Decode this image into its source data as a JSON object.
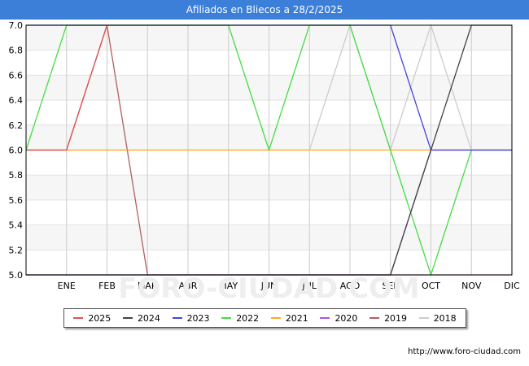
{
  "title": "Afiliados en Bliecos a 28/2/2025",
  "source_text": "http://www.foro-ciudad.com",
  "watermark_text": "FORO-CIUDAD.COM",
  "chart_data": {
    "type": "line",
    "x": [
      "",
      "ENE",
      "FEB",
      "MAR",
      "ABR",
      "MAY",
      "JUN",
      "JUL",
      "AGO",
      "SEP",
      "OCT",
      "NOV",
      "DIC"
    ],
    "ylim": [
      5.0,
      7.0
    ],
    "y_ticks": [
      "5.0",
      "5.2",
      "5.4",
      "5.6",
      "5.8",
      "6.0",
      "6.2",
      "6.4",
      "6.6",
      "6.8",
      "7.0"
    ],
    "grid": true,
    "legend_position": "bottom",
    "series": [
      {
        "name": "2025",
        "color": "#e05050",
        "values": [
          6,
          6,
          7
        ]
      },
      {
        "name": "2024",
        "color": "#444444",
        "values": [
          5,
          5,
          5,
          5,
          5,
          5,
          5,
          5,
          5,
          5,
          6,
          7,
          7
        ]
      },
      {
        "name": "2023",
        "color": "#4444dd",
        "values": [
          7,
          7,
          7,
          7,
          7,
          7,
          7,
          7,
          7,
          7,
          6,
          6,
          6
        ]
      },
      {
        "name": "2022",
        "color": "#44dd44",
        "values": [
          6,
          7,
          7,
          7,
          7,
          7,
          6,
          7,
          7,
          6,
          5,
          6,
          6
        ]
      },
      {
        "name": "2021",
        "color": "#ffaa22",
        "values": [
          6,
          6,
          6,
          6,
          6,
          6,
          6,
          6,
          6,
          6,
          6,
          6,
          6
        ]
      },
      {
        "name": "2020",
        "color": "#aa55dd",
        "values": [
          5,
          5,
          5,
          5,
          5,
          5,
          5,
          5,
          5,
          5,
          6,
          6,
          6
        ]
      },
      {
        "name": "2019",
        "color": "#b06060",
        "values": [
          6,
          6,
          7,
          5,
          5,
          5,
          5,
          5,
          5,
          5,
          5,
          5,
          5
        ]
      },
      {
        "name": "2018",
        "color": "#cccccc",
        "values": [
          6,
          6,
          6,
          6,
          6,
          6,
          6,
          6,
          7,
          6,
          7,
          6,
          6
        ]
      }
    ]
  }
}
